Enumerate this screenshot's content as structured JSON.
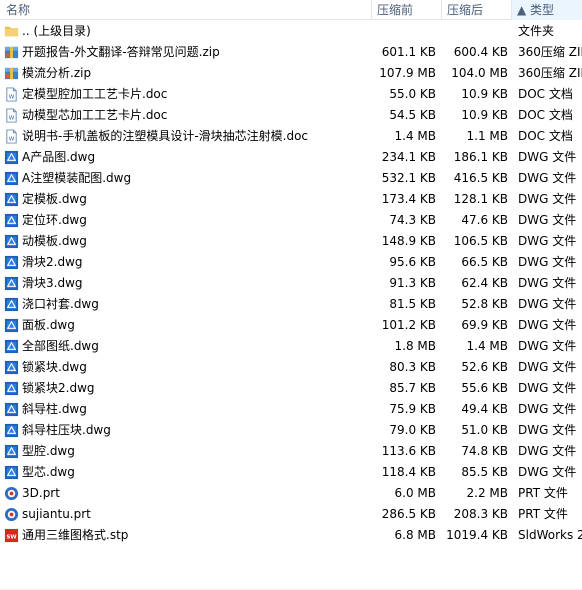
{
  "header": {
    "name": "名称",
    "compressed": "压缩前",
    "original": "压缩后",
    "type": "▲ 类型"
  },
  "files": [
    {
      "name": ".. (上级目录)",
      "compressed": "",
      "original": "",
      "type": "文件夹",
      "icon": "folder-icon"
    },
    {
      "name": "开题报告-外文翻译-答辩常见问题.zip",
      "compressed": "601.1 KB",
      "original": "600.4 KB",
      "type": "360压缩 ZIP 文件",
      "icon": "zip-archive-icon"
    },
    {
      "name": "模流分析.zip",
      "compressed": "107.9 MB",
      "original": "104.0 MB",
      "type": "360压缩 ZIP 文件",
      "icon": "zip-archive-icon"
    },
    {
      "name": "定模型腔加工工艺卡片.doc",
      "compressed": "55.0 KB",
      "original": "10.9 KB",
      "type": "DOC 文档",
      "icon": "doc-icon"
    },
    {
      "name": "动模型芯加工工艺卡片.doc",
      "compressed": "54.5 KB",
      "original": "10.9 KB",
      "type": "DOC 文档",
      "icon": "doc-icon"
    },
    {
      "name": "说明书-手机盖板的注塑模具设计-滑块抽芯注射模.doc",
      "compressed": "1.4 MB",
      "original": "1.1 MB",
      "type": "DOC 文档",
      "icon": "doc-icon"
    },
    {
      "name": "A产品图.dwg",
      "compressed": "234.1 KB",
      "original": "186.1 KB",
      "type": "DWG 文件",
      "icon": "dwg-icon"
    },
    {
      "name": "A注塑模装配图.dwg",
      "compressed": "532.1 KB",
      "original": "416.5 KB",
      "type": "DWG 文件",
      "icon": "dwg-icon"
    },
    {
      "name": "定模板.dwg",
      "compressed": "173.4 KB",
      "original": "128.1 KB",
      "type": "DWG 文件",
      "icon": "dwg-icon"
    },
    {
      "name": "定位环.dwg",
      "compressed": "74.3 KB",
      "original": "47.6 KB",
      "type": "DWG 文件",
      "icon": "dwg-icon"
    },
    {
      "name": "动模板.dwg",
      "compressed": "148.9 KB",
      "original": "106.5 KB",
      "type": "DWG 文件",
      "icon": "dwg-icon"
    },
    {
      "name": "滑块2.dwg",
      "compressed": "95.6 KB",
      "original": "66.5 KB",
      "type": "DWG 文件",
      "icon": "dwg-icon"
    },
    {
      "name": "滑块3.dwg",
      "compressed": "91.3 KB",
      "original": "62.4 KB",
      "type": "DWG 文件",
      "icon": "dwg-icon"
    },
    {
      "name": "浇口衬套.dwg",
      "compressed": "81.5 KB",
      "original": "52.8 KB",
      "type": "DWG 文件",
      "icon": "dwg-icon"
    },
    {
      "name": "面板.dwg",
      "compressed": "101.2 KB",
      "original": "69.9 KB",
      "type": "DWG 文件",
      "icon": "dwg-icon"
    },
    {
      "name": "全部图纸.dwg",
      "compressed": "1.8 MB",
      "original": "1.4 MB",
      "type": "DWG 文件",
      "icon": "dwg-icon"
    },
    {
      "name": "锁紧块.dwg",
      "compressed": "80.3 KB",
      "original": "52.6 KB",
      "type": "DWG 文件",
      "icon": "dwg-icon"
    },
    {
      "name": "锁紧块2.dwg",
      "compressed": "85.7 KB",
      "original": "55.6 KB",
      "type": "DWG 文件",
      "icon": "dwg-icon"
    },
    {
      "name": "斜导柱.dwg",
      "compressed": "75.9 KB",
      "original": "49.4 KB",
      "type": "DWG 文件",
      "icon": "dwg-icon"
    },
    {
      "name": "斜导柱压块.dwg",
      "compressed": "79.0 KB",
      "original": "51.0 KB",
      "type": "DWG 文件",
      "icon": "dwg-icon"
    },
    {
      "name": "型腔.dwg",
      "compressed": "113.6 KB",
      "original": "74.8 KB",
      "type": "DWG 文件",
      "icon": "dwg-icon"
    },
    {
      "name": "型芯.dwg",
      "compressed": "118.4 KB",
      "original": "85.5 KB",
      "type": "DWG 文件",
      "icon": "dwg-icon"
    },
    {
      "name": "3D.prt",
      "compressed": "6.0 MB",
      "original": "2.2 MB",
      "type": "PRT 文件",
      "icon": "prt-icon"
    },
    {
      "name": "sujiantu.prt",
      "compressed": "286.5 KB",
      "original": "208.3 KB",
      "type": "PRT 文件",
      "icon": "prt-icon"
    },
    {
      "name": "通用三维图格式.stp",
      "compressed": "6.8 MB",
      "original": "1019.4 KB",
      "type": "SldWorks 2",
      "icon": "stp-icon"
    }
  ]
}
